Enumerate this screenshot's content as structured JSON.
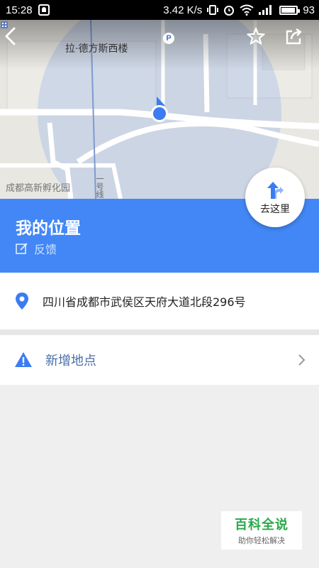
{
  "status_bar": {
    "time": "15:28",
    "speed": "3.42 K/s",
    "battery": "93"
  },
  "map": {
    "poi_label": "拉·德方斯西楼",
    "parking_icon": "P",
    "area_label": "成都高新孵化园",
    "road_label": "一号线"
  },
  "go_button": {
    "label": "去这里"
  },
  "place": {
    "title": "我的位置",
    "feedback_label": "反馈"
  },
  "address": {
    "text": "四川省成都市武侯区天府大道北段296号"
  },
  "add_place": {
    "label": "新增地点"
  },
  "watermark": {
    "main": "百科全说",
    "sub": "助你轻松解决"
  },
  "colors": {
    "accent": "#4287f5",
    "location_dot": "#3b7cf2",
    "watermark_green": "#2aa84a"
  },
  "icons": {
    "back": "back-arrow-icon",
    "favorite": "star-icon",
    "share": "share-icon",
    "address": "location-pin-icon",
    "add_place": "warning-icon",
    "feedback": "edit-icon"
  }
}
